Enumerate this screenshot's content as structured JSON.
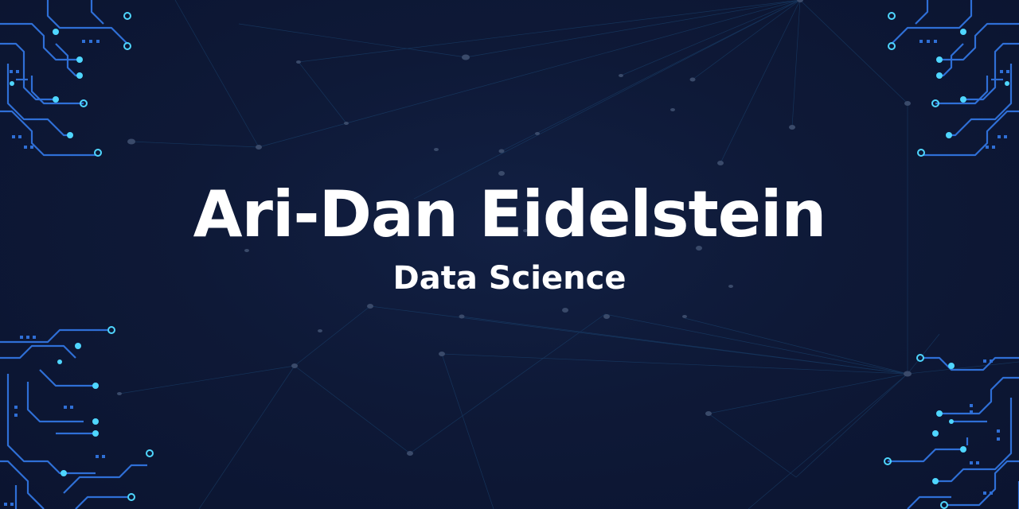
{
  "banner": {
    "title": "Ari-Dan Eidelstein",
    "subtitle": "Data Science"
  },
  "colors": {
    "background": "#0d1733",
    "title_text": "#ffffff",
    "circuit_primary": "#2f6fd6",
    "circuit_accent": "#4fd6ff",
    "network_lines": "#1c4a78",
    "network_nodes": "#3a4a6a"
  },
  "decorations": {
    "corner_graphics": "circuit-board",
    "background_pattern": "network-constellation"
  }
}
